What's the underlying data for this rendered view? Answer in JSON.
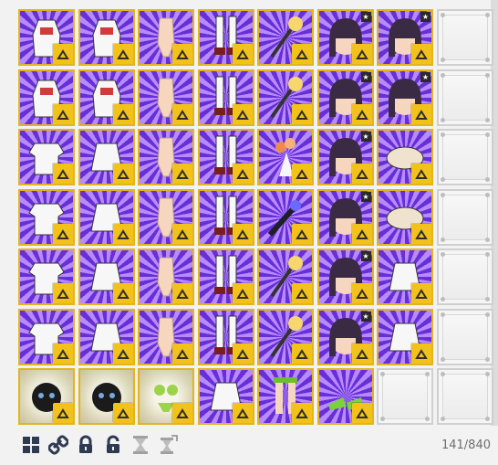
{
  "inventory": {
    "count_text": "141/840",
    "rows": [
      [
        "dress",
        "dress",
        "gloves",
        "stockings",
        "wand",
        "head_star",
        "head_star",
        "empty"
      ],
      [
        "dress",
        "dress",
        "gloves",
        "stockings",
        "wand",
        "head_star",
        "head_star",
        "empty"
      ],
      [
        "top",
        "skirt",
        "glove",
        "boots",
        "bouquet",
        "head_star",
        "hat",
        "empty"
      ],
      [
        "jacket",
        "skirt",
        "glove",
        "boots",
        "weapon",
        "head_star",
        "hat",
        "empty"
      ],
      [
        "top",
        "skirt",
        "glove",
        "boots",
        "wand",
        "head_star",
        "skirt",
        "empty"
      ],
      [
        "top",
        "skirt",
        "glove",
        "boots",
        "wand",
        "head_star",
        "skirt",
        "empty"
      ],
      [
        "pet",
        "pet",
        "bikini",
        "skirt",
        "legs",
        "shoes",
        "empty",
        "empty"
      ]
    ],
    "colors": {
      "slot_border": "#e1b51b",
      "purple_light": "#b58cff",
      "purple_dark": "#6a2ed6",
      "hanger": "#f3c21a"
    }
  },
  "toolbar": {
    "icons": [
      "grid-icon",
      "link-icon",
      "lock-icon",
      "unlock-icon",
      "hourglass-icon",
      "hourglass-arrow-icon"
    ]
  }
}
